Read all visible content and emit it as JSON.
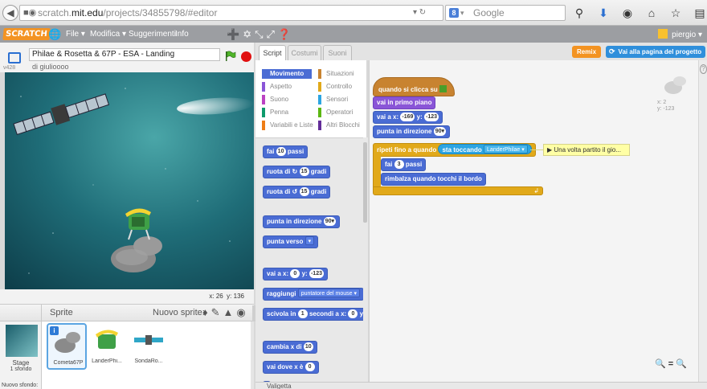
{
  "browser": {
    "url_prefix": "scratch.",
    "url_host": "mit.edu",
    "url_path": "/projects/34855798/#editor",
    "search_placeholder": "Google",
    "search_engine_badge": "8"
  },
  "menubar": {
    "logo": "SCRATCH",
    "items": [
      "File ▾",
      "Modifica ▾",
      "Suggerimenti",
      "Info"
    ],
    "user": "piergio ▾"
  },
  "stage_header": {
    "project_title": "Philae & Rosetta & 67P - ESA - Landing",
    "author": "di giulioooo",
    "version": "v428"
  },
  "stage": {
    "mouse_x_label": "x:",
    "mouse_x": "26",
    "mouse_y_label": "y:",
    "mouse_y": "136"
  },
  "sprites": {
    "title": "Sprite",
    "new_sprite_label": "Nuovo sprite:",
    "stage_label": "Stage",
    "stage_backdrops": "1 sfondo",
    "new_backdrop_label": "Nuovo sfondo:",
    "items": [
      {
        "name": "Cometa67P",
        "selected": true
      },
      {
        "name": "LanderPhi...",
        "selected": false
      },
      {
        "name": "SondaRo...",
        "selected": false
      }
    ]
  },
  "tabs": [
    "Script",
    "Costumi",
    "Suoni"
  ],
  "buttons": {
    "remix": "Remix",
    "project_page": "Vai alla pagina del progetto"
  },
  "categories": [
    {
      "label": "Movimento",
      "color": "#4a6cd4",
      "active": true
    },
    {
      "label": "Situazioni",
      "color": "#c88330",
      "active": false
    },
    {
      "label": "Aspetto",
      "color": "#8a55d7",
      "active": false
    },
    {
      "label": "Controllo",
      "color": "#e1a91a",
      "active": false
    },
    {
      "label": "Suono",
      "color": "#bb42c3",
      "active": false
    },
    {
      "label": "Sensori",
      "color": "#2ca5e2",
      "active": false
    },
    {
      "label": "Penna",
      "color": "#0e9a6c",
      "active": false
    },
    {
      "label": "Operatori",
      "color": "#5cb712",
      "active": false
    },
    {
      "label": "Variabili e Liste",
      "color": "#ee7d16",
      "active": false
    },
    {
      "label": "Altri Blocchi",
      "color": "#632d99",
      "active": false
    }
  ],
  "palette": {
    "move": {
      "pre": "fai",
      "n": "10",
      "post": "passi"
    },
    "turn_right": {
      "pre": "ruota di ↻",
      "n": "15",
      "post": "gradi"
    },
    "turn_left": {
      "pre": "ruota di ↺",
      "n": "15",
      "post": "gradi"
    },
    "point_dir": {
      "pre": "punta in direzione",
      "n": "90▾"
    },
    "point_to": {
      "pre": "punta verso",
      "drop": "▾"
    },
    "goto_xy": {
      "pre": "vai a x:",
      "x": "0",
      "mid": "y:",
      "y": "-123"
    },
    "goto": {
      "pre": "raggiungi",
      "drop": "puntatore del mouse ▾"
    },
    "glide": {
      "pre": "scivola in",
      "n": "1",
      "mid": "secondi a x:",
      "x": "0",
      "post": "y:"
    },
    "change_x": {
      "pre": "cambia x di",
      "n": "10"
    },
    "set_x": {
      "pre": "vai dove x è",
      "n": "0"
    }
  },
  "script": {
    "when_flag": "quando si clicca su",
    "front": "vai in primo piano",
    "goto_pre": "vai a x:",
    "goto_x": "-169",
    "goto_mid": "y:",
    "goto_y": "-123",
    "dir_pre": "punta in direzione",
    "dir_n": "90▾",
    "repeat_pre": "ripeti fino a quando",
    "touching_pre": "sta toccando",
    "touching_target": "LanderPhilae ▾",
    "move_pre": "fai",
    "move_n": "3",
    "move_post": "passi",
    "bounce": "rimbalza quando tocchi il bordo",
    "loop_arrow": "↲",
    "comment": "▶ Una volta partito il gio..."
  },
  "sprite_info": {
    "x_label": "x:",
    "x": "2",
    "y_label": "y:",
    "y": "-123"
  },
  "zoom": {
    "out": "🔍",
    "reset": "=",
    "in": "🔍"
  },
  "backpack": "Valigetta"
}
